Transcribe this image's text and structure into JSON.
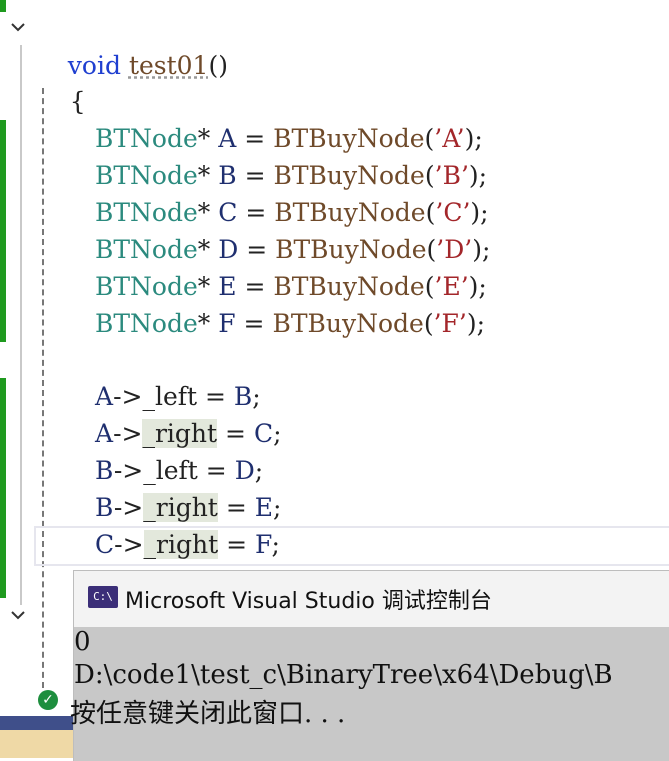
{
  "editor": {
    "signature": {
      "kw": "void",
      "name": "test01",
      "parens": "()"
    },
    "open_brace": "{",
    "nodes": [
      {
        "type": "BTNode",
        "star": "*",
        "var": "A",
        "eq": "=",
        "fn": "BTBuyNode",
        "open": "(",
        "q1": "’",
        "ch": "A",
        "q2": "’",
        "close": ");"
      },
      {
        "type": "BTNode",
        "star": "*",
        "var": "B",
        "eq": "=",
        "fn": "BTBuyNode",
        "open": "(",
        "q1": "’",
        "ch": "B",
        "q2": "’",
        "close": ");"
      },
      {
        "type": "BTNode",
        "star": "*",
        "var": "C",
        "eq": "=",
        "fn": "BTBuyNode",
        "open": "(",
        "q1": "’",
        "ch": "C",
        "q2": "’",
        "close": ");"
      },
      {
        "type": "BTNode",
        "star": "*",
        "var": "D",
        "eq": "=",
        "fn": "BTBuyNode",
        "open": "(",
        "q1": "’",
        "ch": "D",
        "q2": "’",
        "close": ");"
      },
      {
        "type": "BTNode",
        "star": "*",
        "var": "E",
        "eq": "=",
        "fn": "BTBuyNode",
        "open": "(",
        "q1": "’",
        "ch": "E",
        "q2": "’",
        "close": ");"
      },
      {
        "type": "BTNode",
        "star": "*",
        "var": "F",
        "eq": "=",
        "fn": "BTBuyNode",
        "open": "(",
        "q1": "’",
        "ch": "F",
        "q2": "’",
        "close": ");"
      }
    ],
    "links": [
      {
        "lhs": "A",
        "arrow": "->",
        "member": "_left",
        "eq": "=",
        "rhs": "B",
        "end": ";"
      },
      {
        "lhs": "A",
        "arrow": "->",
        "member": "_right",
        "eq": "=",
        "rhs": "C",
        "end": ";"
      },
      {
        "lhs": "B",
        "arrow": "->",
        "member": "_left",
        "eq": "=",
        "rhs": "D",
        "end": ";"
      },
      {
        "lhs": "B",
        "arrow": "->",
        "member": "_right",
        "eq": "=",
        "rhs": "E",
        "end": ";"
      },
      {
        "lhs": "C",
        "arrow": "->",
        "member": "_right",
        "eq": "=",
        "rhs": "F",
        "end": ";"
      }
    ]
  },
  "console": {
    "icon_text": "C:\\",
    "title": "Microsoft Visual Studio 调试控制台",
    "lines": [
      "0",
      "D:\\code1\\test_c\\BinaryTree\\x64\\Debug\\B",
      "按任意键关闭此窗口. . ."
    ]
  },
  "icons": {
    "collapse": "chevron-down-icon",
    "status": "check-circle-icon",
    "console": "console-app-icon"
  },
  "colors": {
    "keyword": "#1f3fd0",
    "type": "#2b8a7e",
    "string": "#a3262a",
    "function": "#6f4a2a",
    "change_bar": "#1f9a1f"
  }
}
